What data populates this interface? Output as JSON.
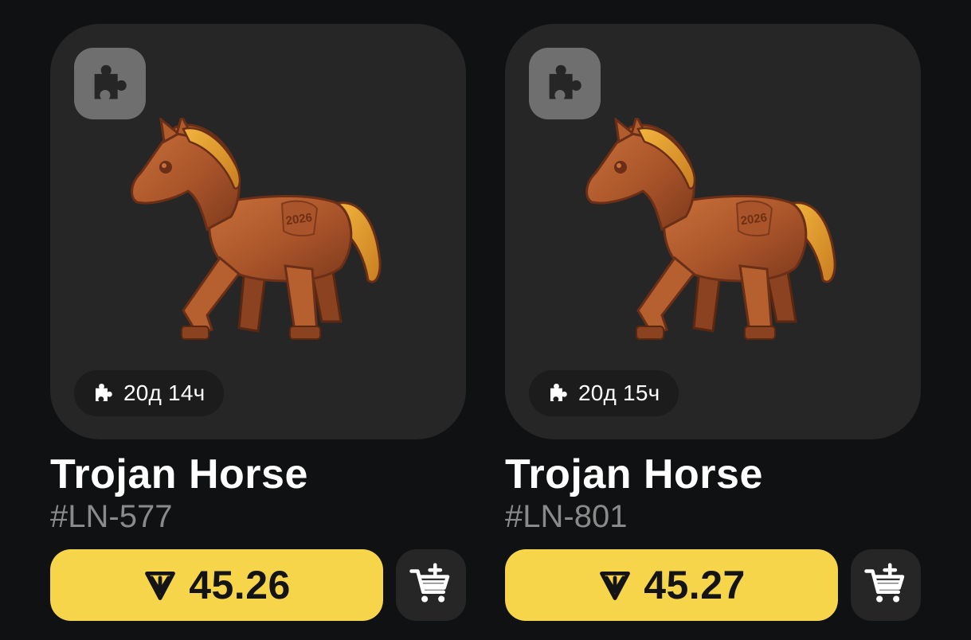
{
  "items": [
    {
      "title": "Trojan Horse",
      "serial": "#LN-577",
      "timer": "20д 14ч",
      "price": "45.26",
      "horse_mark": "2026"
    },
    {
      "title": "Trojan Horse",
      "serial": "#LN-801",
      "timer": "20д 15ч",
      "price": "45.27",
      "horse_mark": "2026"
    }
  ],
  "icons": {
    "badge": "puzzle-icon",
    "timer": "puzzle-icon",
    "currency": "ton-icon",
    "cart": "add-to-cart-icon"
  },
  "colors": {
    "background": "#101112",
    "card": "#262626",
    "accent": "#f7d54a",
    "serial": "#8a8a8a"
  }
}
